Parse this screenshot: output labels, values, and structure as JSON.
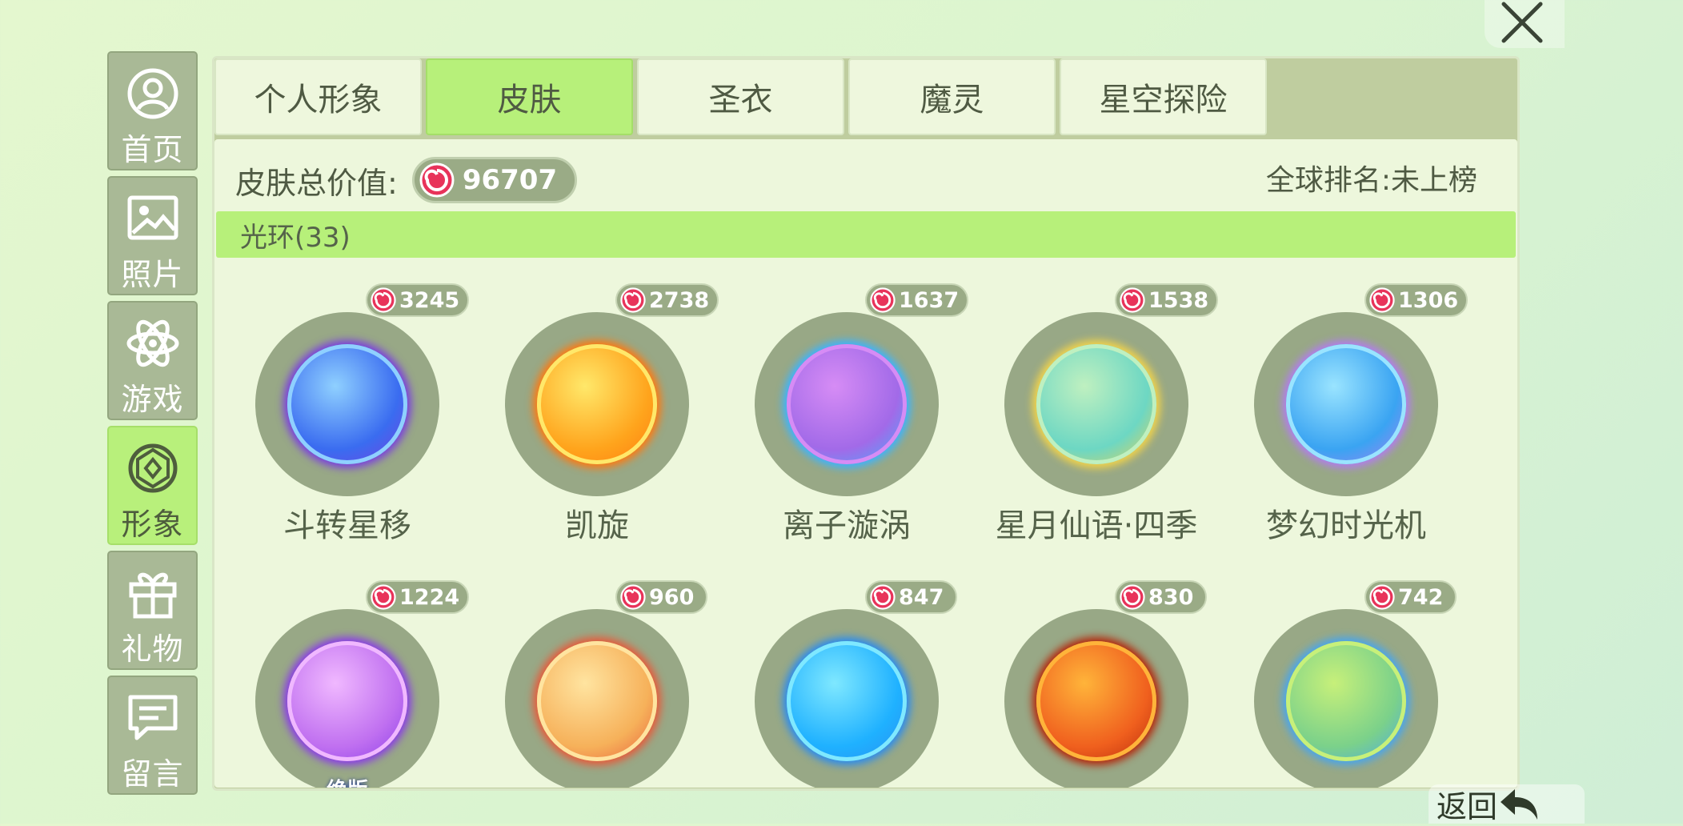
{
  "sidebar": {
    "items": [
      {
        "label": "首页",
        "icon": "user-circle-icon"
      },
      {
        "label": "照片",
        "icon": "photo-icon"
      },
      {
        "label": "游戏",
        "icon": "atom-icon"
      },
      {
        "label": "形象",
        "icon": "diamond-icon"
      },
      {
        "label": "礼物",
        "icon": "gift-icon"
      },
      {
        "label": "留言",
        "icon": "chat-icon"
      }
    ],
    "active": "形象"
  },
  "tabs": [
    {
      "label": "个人形象"
    },
    {
      "label": "皮肤"
    },
    {
      "label": "圣衣"
    },
    {
      "label": "魔灵"
    },
    {
      "label": "星空探险"
    }
  ],
  "active_tab": "皮肤",
  "summary": {
    "value_label": "皮肤总价值:",
    "value": "96707",
    "rank_label": "全球排名:",
    "rank_value": "未上榜"
  },
  "section": {
    "title": "光环(33)"
  },
  "items": [
    {
      "price": "3245",
      "name": "斗转星移",
      "gradient": [
        "#8fd0ff",
        "#3a6cf0",
        "#7a3ee0"
      ]
    },
    {
      "price": "2738",
      "name": "凯旋",
      "gradient": [
        "#ffe86a",
        "#ffa41c",
        "#ff7a10"
      ]
    },
    {
      "price": "1637",
      "name": "离子漩涡",
      "gradient": [
        "#d68cf5",
        "#a26ae8",
        "#3cb4ff"
      ]
    },
    {
      "price": "1538",
      "name": "星月仙语·四季",
      "gradient": [
        "#bff0c0",
        "#6dd7c3",
        "#f3d44a"
      ]
    },
    {
      "price": "1306",
      "name": "梦幻时光机",
      "gradient": [
        "#9ae4ff",
        "#3aa4f2",
        "#b27cf0"
      ]
    },
    {
      "price": "1224",
      "name": "",
      "gradient": [
        "#f0b8ff",
        "#c070f0",
        "#8a3be8"
      ],
      "badge": "绝版"
    },
    {
      "price": "960",
      "name": "",
      "gradient": [
        "#ffe4a0",
        "#f6b15a",
        "#e85a3a"
      ]
    },
    {
      "price": "847",
      "name": "",
      "gradient": [
        "#7fe8ff",
        "#1fb1ff",
        "#2a8cf0"
      ]
    },
    {
      "price": "830",
      "name": "",
      "gradient": [
        "#ffb43a",
        "#f0601e",
        "#b4260a"
      ]
    },
    {
      "price": "742",
      "name": "",
      "gradient": [
        "#c7f07a",
        "#7bd18a",
        "#48a6ee"
      ]
    }
  ],
  "back": {
    "label": "返回"
  },
  "colors": {
    "accent": "#b7f07a",
    "panel": "#bfcd9f",
    "candy": "#e8335a"
  }
}
